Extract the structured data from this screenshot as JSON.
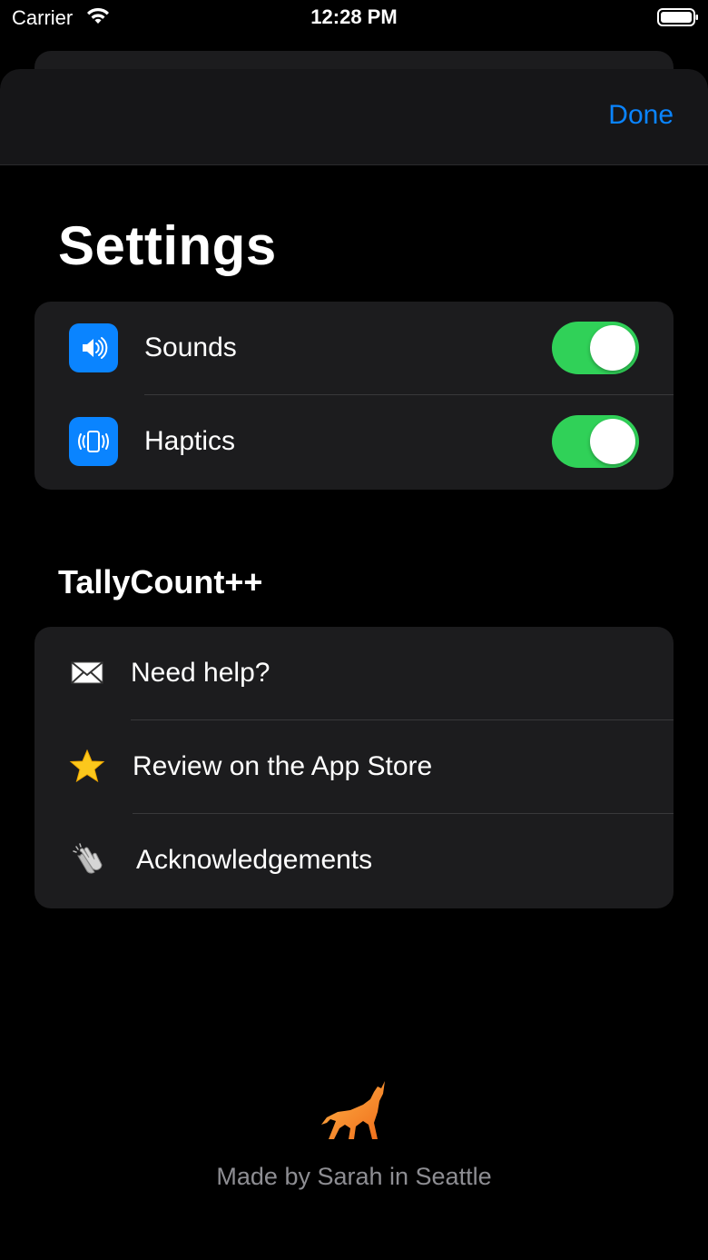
{
  "status_bar": {
    "carrier": "Carrier",
    "time": "12:28 PM"
  },
  "nav": {
    "done_label": "Done"
  },
  "page": {
    "title": "Settings"
  },
  "toggles": [
    {
      "label": "Sounds",
      "icon": "speaker-icon",
      "on": true
    },
    {
      "label": "Haptics",
      "icon": "haptics-icon",
      "on": true
    }
  ],
  "section": {
    "title": "TallyCount++"
  },
  "links": [
    {
      "label": "Need help?",
      "icon": "envelope-icon"
    },
    {
      "label": "Review on the App Store",
      "icon": "star-icon"
    },
    {
      "label": "Acknowledgements",
      "icon": "clapping-hands-icon"
    }
  ],
  "footer": {
    "credit": "Made by Sarah in Seattle",
    "logo_icon": "wolf-icon"
  },
  "colors": {
    "accent": "#0a84ff",
    "toggle_on": "#30d158",
    "group_bg": "#1c1c1e",
    "footer_text": "#8e8e93"
  }
}
